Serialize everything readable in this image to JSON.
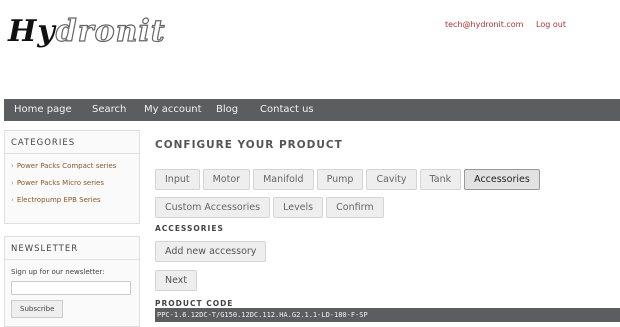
{
  "brand": {
    "logo_part1": "Hy",
    "logo_part2": "dronit"
  },
  "user": {
    "email": "tech@hydronit.com",
    "logout": "Log out"
  },
  "nav": [
    "Home page",
    "Search",
    "My account",
    "Blog",
    "Contact us"
  ],
  "sidebar": {
    "categories_title": "CATEGORIES",
    "categories": [
      "Power Packs Compact series",
      "Power Packs Micro series",
      "Electropump EPB Series"
    ],
    "newsletter_title": "NEWSLETTER",
    "newsletter_text": "Sign up for our newsletter:",
    "newsletter_input_value": "",
    "subscribe_label": "Subscribe"
  },
  "main": {
    "title": "CONFIGURE YOUR PRODUCT",
    "tabs": [
      "Input",
      "Motor",
      "Manifold",
      "Pump",
      "Cavity",
      "Tank",
      "Accessories",
      "Custom Accessories",
      "Levels",
      "Confirm"
    ],
    "active_tab": "Accessories",
    "section_label": "ACCESSORIES",
    "add_button": "Add new accessory",
    "next_button": "Next",
    "product_code_label": "PRODUCT CODE",
    "product_code": "PPC-1.6.12DC-T/G150.12DC.112.HA.G2.1.1-LD-180-F-SP"
  },
  "colors": {
    "navbar": "#5b5e61",
    "link": "#aa3333",
    "category_link": "#8a5a2a"
  }
}
